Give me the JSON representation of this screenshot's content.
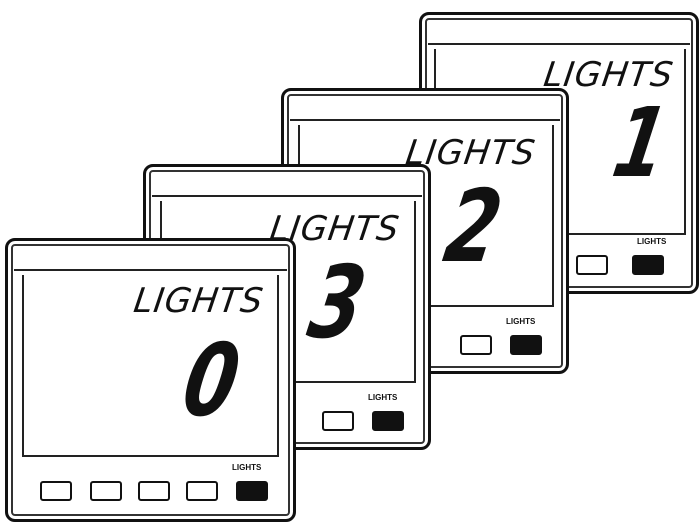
{
  "units": [
    {
      "word": "LIGHTS",
      "digit": "1",
      "button_label": "LIGHTS"
    },
    {
      "word": "LIGHTS",
      "digit": "2",
      "button_label": "LIGHTS"
    },
    {
      "word": "LIGHTS",
      "digit": "3",
      "button_label": "LIGHTS"
    },
    {
      "word": "LIGHTS",
      "digit": "0",
      "button_label": "LIGHTS"
    }
  ]
}
